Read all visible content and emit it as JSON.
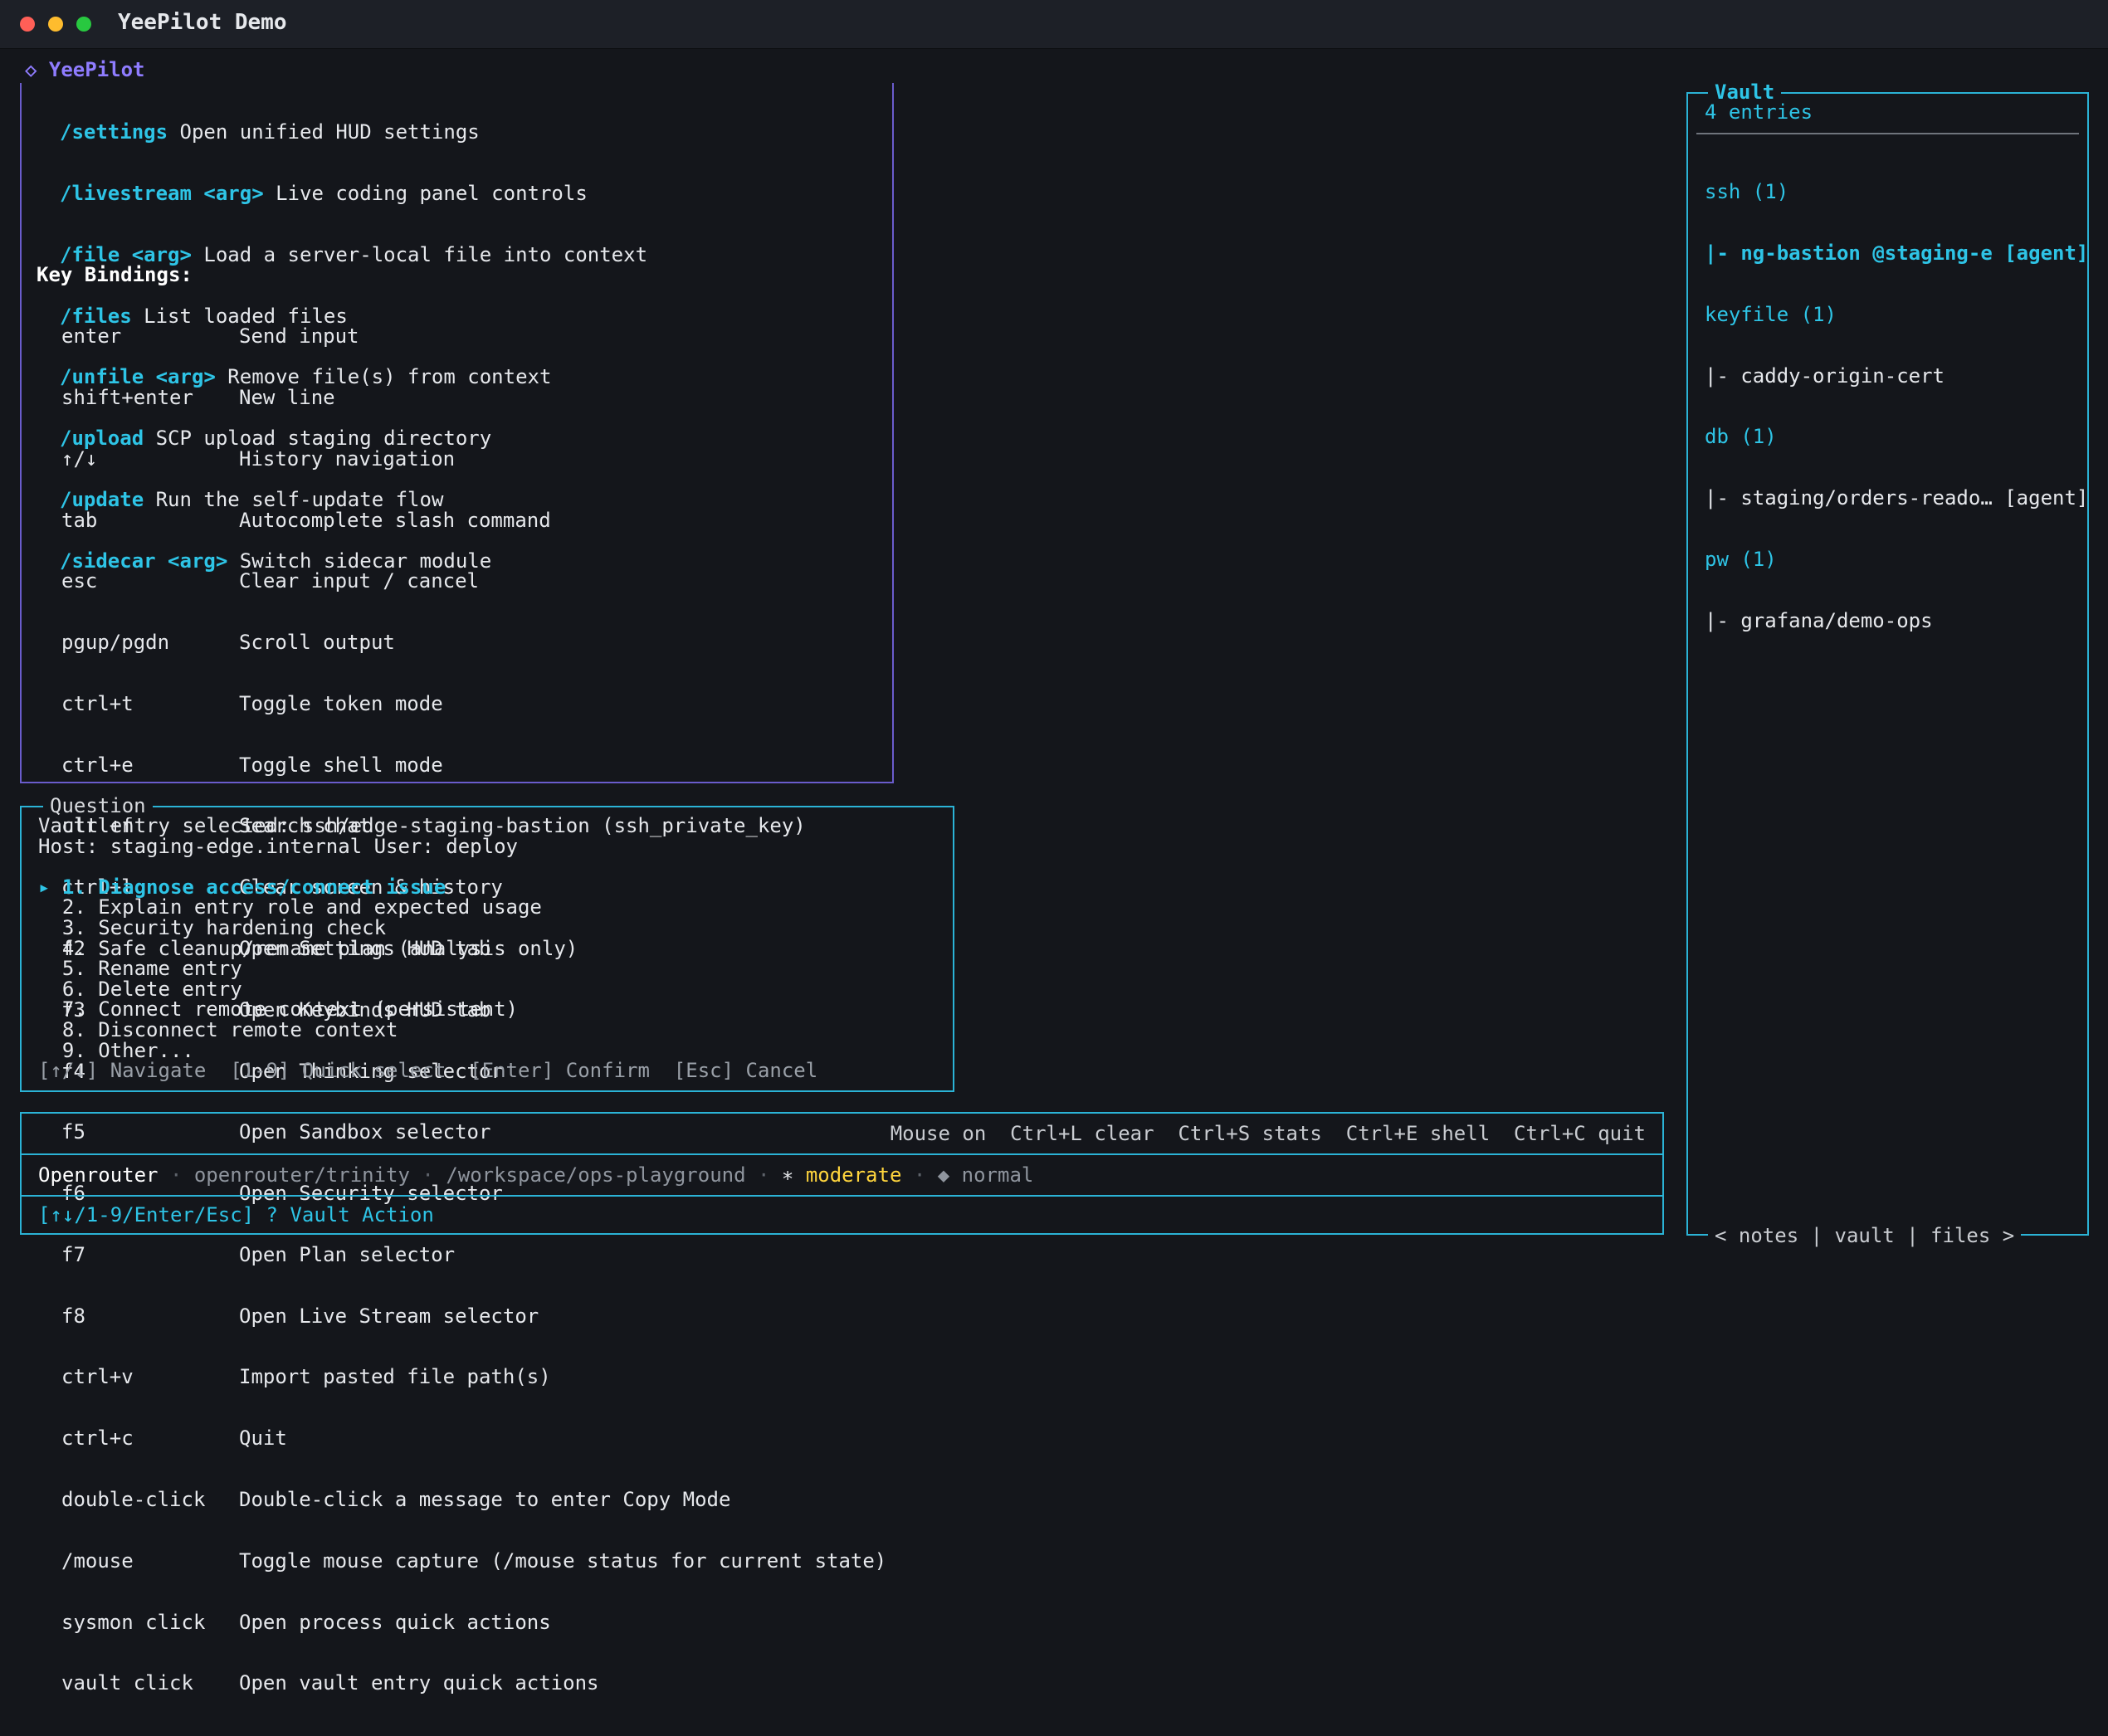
{
  "window": {
    "title": "YeePilot Demo"
  },
  "app": {
    "name": "◇ YeePilot"
  },
  "commands": [
    {
      "cmd": "/settings",
      "desc": " Open unified HUD settings"
    },
    {
      "cmd": "/livestream <arg>",
      "desc": " Live coding panel controls"
    },
    {
      "cmd": "/file <arg>",
      "desc": " Load a server-local file into context"
    },
    {
      "cmd": "/files",
      "desc": " List loaded files"
    },
    {
      "cmd": "/unfile <arg>",
      "desc": " Remove file(s) from context"
    },
    {
      "cmd": "/upload",
      "desc": " SCP upload staging directory"
    },
    {
      "cmd": "/update",
      "desc": " Run the self-update flow"
    },
    {
      "cmd": "/sidecar <arg>",
      "desc": " Switch sidecar module"
    }
  ],
  "key_bindings": {
    "title": "Key Bindings:",
    "items": [
      {
        "key": "enter",
        "desc": "Send input"
      },
      {
        "key": "shift+enter",
        "desc": "New line"
      },
      {
        "key": "↑/↓",
        "desc": "History navigation"
      },
      {
        "key": "tab",
        "desc": "Autocomplete slash command"
      },
      {
        "key": "esc",
        "desc": "Clear input / cancel"
      },
      {
        "key": "pgup/pgdn",
        "desc": "Scroll output"
      },
      {
        "key": "ctrl+t",
        "desc": "Toggle token mode"
      },
      {
        "key": "ctrl+e",
        "desc": "Toggle shell mode"
      },
      {
        "key": "ctrl+f",
        "desc": "Search chat"
      },
      {
        "key": "ctrl+l",
        "desc": "Clear screen & history"
      },
      {
        "key": "f2",
        "desc": "Open Settings HUD tab"
      },
      {
        "key": "f3",
        "desc": "Open Keybinds HUD tab"
      },
      {
        "key": "f4",
        "desc": "Open Thinking selector"
      },
      {
        "key": "f5",
        "desc": "Open Sandbox selector"
      },
      {
        "key": "f6",
        "desc": "Open Security selector"
      },
      {
        "key": "f7",
        "desc": "Open Plan selector"
      },
      {
        "key": "f8",
        "desc": "Open Live Stream selector"
      },
      {
        "key": "ctrl+v",
        "desc": "Import pasted file path(s)"
      },
      {
        "key": "ctrl+c",
        "desc": "Quit"
      },
      {
        "key": "double-click",
        "desc": "Double-click a message to enter Copy Mode"
      },
      {
        "key": "/mouse",
        "desc": "Toggle mouse capture (/mouse status for current state)"
      },
      {
        "key": "sysmon click",
        "desc": "Open process quick actions"
      },
      {
        "key": "vault click",
        "desc": "Open vault entry quick actions"
      }
    ]
  },
  "question": {
    "title": "Question",
    "line1": "Vault entry selected: ssh/edge-staging-bastion (ssh_private_key)",
    "line2": "Host: staging-edge.internal User: deploy",
    "options": [
      "▸ 1. Diagnose access/connect issue",
      "  2. Explain entry role and expected usage",
      "  3. Security hardening check",
      "  4. Safe cleanup/rename plan (analysis only)",
      "  5. Rename entry",
      "  6. Delete entry",
      "  7. Connect remote context (persistent)",
      "  8. Disconnect remote context",
      "  9. Other..."
    ],
    "hint": "[↑/↓] Navigate  [1-9] Quick select  [Enter] Confirm  [Esc] Cancel"
  },
  "shortcuts": "Mouse on  Ctrl+L clear  Ctrl+S stats  Ctrl+E shell  Ctrl+C quit",
  "status": {
    "provider": "Openrouter",
    "sep": " · ",
    "model": "openrouter/trinity",
    "path": "/workspace/ops-playground",
    "effort_icon": "∗ ",
    "effort": "moderate",
    "mode": "◆ normal"
  },
  "action_bar": "[↑↓/1-9/Enter/Esc] ? Vault Action",
  "vault": {
    "title": "Vault",
    "count": "4 entries",
    "rows": [
      {
        "text": "ssh (1)",
        "type": "cat"
      },
      {
        "text": "|- ng-bastion @staging-e [agent]",
        "type": "active"
      },
      {
        "text": "keyfile (1)",
        "type": "cat"
      },
      {
        "text": "|- caddy-origin-cert",
        "type": "item"
      },
      {
        "text": "db (1)",
        "type": "cat"
      },
      {
        "text": "|- staging/orders-reado… [agent]",
        "type": "item"
      },
      {
        "text": "pw (1)",
        "type": "cat"
      },
      {
        "text": "|- grafana/demo-ops",
        "type": "item"
      }
    ],
    "nav": "< notes | vault | files >"
  },
  "colors": {
    "accent_cyan": "#2ec4e6",
    "accent_purple": "#8f7cff",
    "warning_yellow": "#ffd53d",
    "background": "#14161b"
  }
}
